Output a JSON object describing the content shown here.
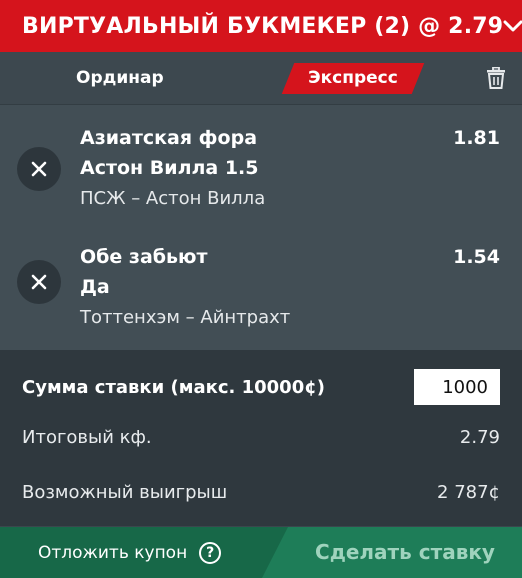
{
  "header": {
    "title": "ВИРТУАЛЬНЫЙ БУКМЕКЕР (2) @ 2.79",
    "collapse_icon": "chevron-down-icon"
  },
  "tabs": {
    "single": "Ординар",
    "express": "Экспресс",
    "active": "express",
    "accent": "#d5141c"
  },
  "bets": [
    {
      "market": "Азиатская фора",
      "pick": "Астон Вилла 1.5",
      "match": "ПСЖ – Астон Вилла",
      "odds": "1.81"
    },
    {
      "market": "Обе забьют",
      "pick": "Да",
      "match": "Тоттенхэм – Айнтрахт",
      "odds": "1.54"
    }
  ],
  "summary": {
    "stake_label": "Сумма ставки (макс. 10000¢)",
    "stake_value": "1000",
    "total_odds_label": "Итоговый кф.",
    "total_odds_value": "2.79",
    "payout_label": "Возможный выигрыш",
    "payout_value": "2 787¢"
  },
  "footer": {
    "save_label": "Отложить купон",
    "help": "?",
    "place_label": "Сделать ставку"
  }
}
